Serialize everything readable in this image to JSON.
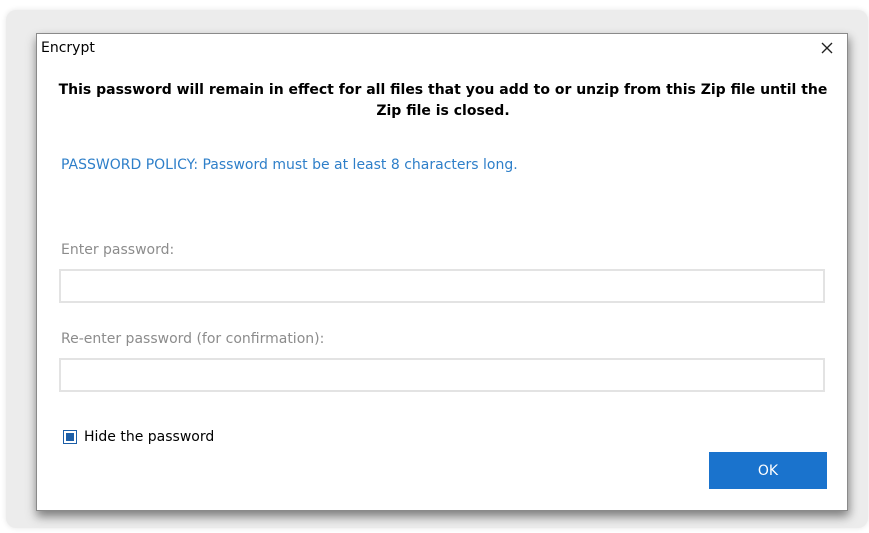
{
  "dialog": {
    "title": "Encrypt",
    "headline": "This password will remain in effect for all files that you add to or unzip from this Zip file until the Zip file is closed.",
    "policy": "PASSWORD POLICY: Password must be at least 8 characters long.",
    "password_label": "Enter password:",
    "password_value": "",
    "confirm_label": "Re-enter password (for confirmation):",
    "confirm_value": "",
    "hide_password_label": "Hide the password",
    "hide_password_checked": true,
    "ok_label": "OK",
    "close_icon": "close-icon"
  },
  "colors": {
    "policy_text": "#2e7fc9",
    "ok_button": "#1a73cd",
    "checkbox": "#1c5fa8"
  }
}
